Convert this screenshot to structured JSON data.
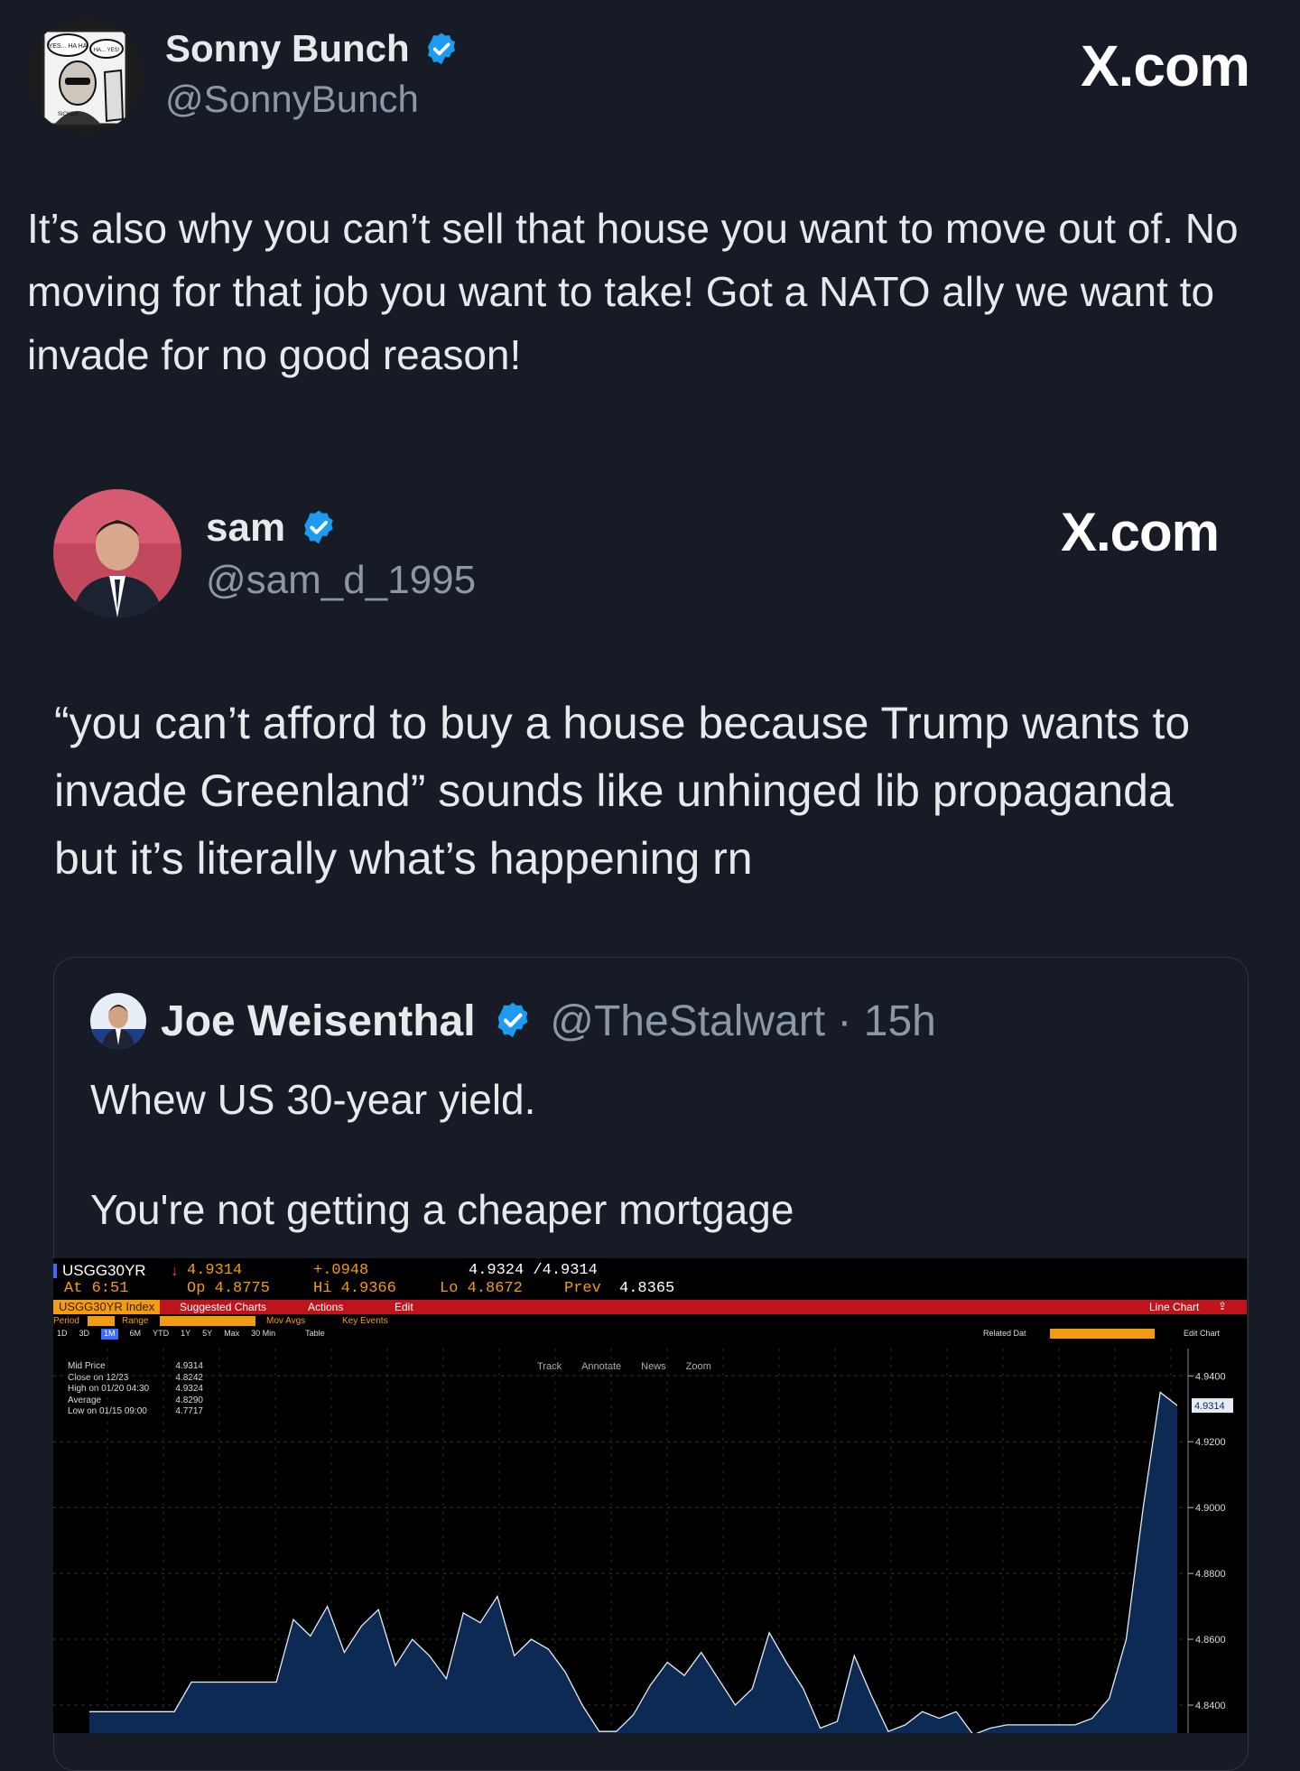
{
  "outer_post": {
    "name": "Sonny Bunch",
    "handle": "@SonnyBunch",
    "site": "X.com",
    "avatar_caption_1": "YES... HA HA",
    "avatar_caption_2": "HA... YES!",
    "avatar_caption_3": "SICKOS",
    "text": "It’s also why you can’t sell that house you want to move out of. No moving for that job you want to take! Got a NATO ally we want to invade for no good reason!"
  },
  "quoted_post": {
    "name": "sam",
    "handle": "@sam_d_1995",
    "site": "X.com",
    "text": "“you can’t afford to buy a house because Trump wants to invade Greenland” sounds like unhinged lib propaganda but it’s literally what’s happening rn"
  },
  "nested_post": {
    "name": "Joe Weisenthal",
    "handle": "@TheStalwart",
    "separator": "·",
    "time": "15h",
    "line1": "Whew US 30-year yield.",
    "line2": "You're not getting a cheaper mortgage"
  },
  "terminal": {
    "ticker": "USGG30YR",
    "last": "4.9314",
    "change": "+.0948",
    "bid_ask": "4.9324 /4.9314",
    "at_label": "At 6:51",
    "open_label": "Op 4.8775",
    "hi_label": "Hi 4.9366",
    "lo_label": "Lo 4.8672",
    "prev_label": "Prev",
    "prev_value": "4.8365",
    "index_tag": "USGG30YR Index",
    "menu_suggested": "Suggested Charts",
    "menu_actions": "Actions",
    "menu_edit": "Edit",
    "line_chart_label": "Line Chart",
    "period_label": "Period",
    "range_label": "Range",
    "mov_avgs": "Mov Avgs",
    "key_events": "Key Events",
    "period_buttons": [
      "1D",
      "3D",
      "1M",
      "6M",
      "YTD",
      "1Y",
      "5Y",
      "Max",
      "30 Min"
    ],
    "table_label": "Table",
    "related": "Related Dat",
    "edit_chart": "Edit Chart",
    "tool_track": "Track",
    "tool_annotate": "Annotate",
    "tool_news": "News",
    "tool_zoom": "Zoom",
    "legend": [
      {
        "label": "Mid Price",
        "value": "4.9314"
      },
      {
        "label": "Close on 12/23",
        "value": "4.8242"
      },
      {
        "label": "High on 01/20 04:30",
        "value": "4.9324"
      },
      {
        "label": "Average",
        "value": "4.8290"
      },
      {
        "label": "Low on 01/15 09:00",
        "value": "4.7717"
      }
    ],
    "y_ticks": [
      "4.9400",
      "4.9200",
      "4.9000",
      "4.8800",
      "4.8600",
      "4.8400"
    ],
    "last_tag": "4.9314"
  },
  "chart_data": {
    "type": "area",
    "title": "USGG30YR",
    "ylim": [
      4.8315,
      4.9483
    ],
    "y_ticks": [
      4.94,
      4.92,
      4.9,
      4.88,
      4.86,
      4.84
    ],
    "series": [
      {
        "name": "Mid Price",
        "values": [
          4.838,
          4.838,
          4.838,
          4.838,
          4.838,
          4.838,
          4.847,
          4.847,
          4.847,
          4.847,
          4.847,
          4.847,
          4.866,
          4.861,
          4.87,
          4.856,
          4.864,
          4.869,
          4.852,
          4.86,
          4.855,
          4.848,
          4.868,
          4.865,
          4.873,
          4.855,
          4.86,
          4.857,
          4.85,
          4.84,
          4.832,
          4.832,
          4.837,
          4.846,
          4.853,
          4.849,
          4.856,
          4.848,
          4.84,
          4.845,
          4.862,
          4.853,
          4.845,
          4.833,
          4.835,
          4.855,
          4.843,
          4.832,
          4.834,
          4.838,
          4.836,
          4.838,
          4.831,
          4.833,
          4.834,
          4.834,
          4.834,
          4.834,
          4.834,
          4.836,
          4.842,
          4.86,
          4.9,
          4.935,
          4.931
        ]
      }
    ]
  },
  "colors": {
    "background": "#161b26",
    "verified": "#1d9bf0",
    "terminal_red_bar": "#c0141c",
    "terminal_amber": "#f39c12",
    "area_fill": "#0d2a55",
    "area_line": "#e6ecf5"
  }
}
